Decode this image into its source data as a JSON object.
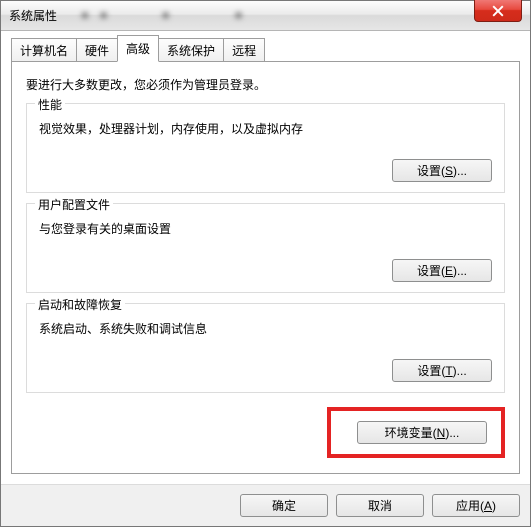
{
  "window": {
    "title": "系统属性"
  },
  "tabs": {
    "t0": "计算机名",
    "t1": "硬件",
    "t2": "高级",
    "t3": "系统保护",
    "t4": "远程"
  },
  "page": {
    "intro": "要进行大多数更改，您必须作为管理员登录。",
    "perf": {
      "title": "性能",
      "desc": "视觉效果，处理器计划，内存使用，以及虚拟内存",
      "btn_prefix": "设置(",
      "btn_accel": "S",
      "btn_suffix": ")..."
    },
    "profile": {
      "title": "用户配置文件",
      "desc": "与您登录有关的桌面设置",
      "btn_prefix": "设置(",
      "btn_accel": "E",
      "btn_suffix": ")..."
    },
    "startup": {
      "title": "启动和故障恢复",
      "desc": "系统启动、系统失败和调试信息",
      "btn_prefix": "设置(",
      "btn_accel": "T",
      "btn_suffix": ")..."
    },
    "env": {
      "btn_prefix": "环境变量(",
      "btn_accel": "N",
      "btn_suffix": ")..."
    }
  },
  "footer": {
    "ok": "确定",
    "cancel": "取消",
    "apply_prefix": "应用(",
    "apply_accel": "A",
    "apply_suffix": ")"
  }
}
